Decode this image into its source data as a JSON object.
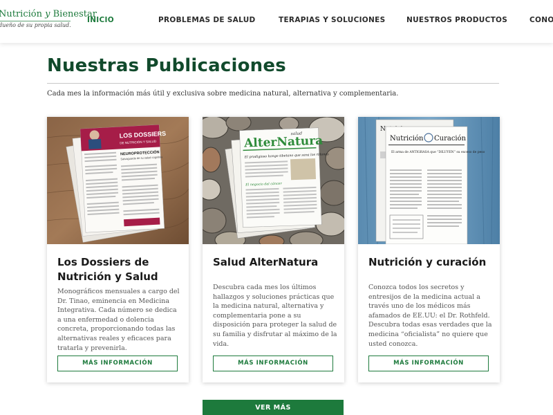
{
  "brand": {
    "title_part1": "Nutrición",
    "title_amp": "y",
    "title_part2": "Bienestar",
    "tagline": "dueño de su propia salud."
  },
  "nav": {
    "items": [
      {
        "label": "INICIO",
        "active": true
      },
      {
        "label": "PROBLEMAS DE SALUD",
        "active": false
      },
      {
        "label": "TERAPIAS Y SOLUCIONES",
        "active": false
      },
      {
        "label": "NUESTROS PRODUCTOS",
        "active": false
      },
      {
        "label": "CONOZ",
        "active": false
      }
    ]
  },
  "section": {
    "title": "Nuestras Publicaciones",
    "subtitle": "Cada mes la información más útil y exclusiva sobre medicina natural, alternativa y complementaria."
  },
  "cards": [
    {
      "title": "Los Dossiers de Nutrición y Salud",
      "description": "Monográficos mensuales a cargo del Dr. Tinao, eminencia en Medicina Integrativa. Cada número se dedica a una enfermedad o dolencia concreta, proporcionando todas las alternativas reales y eficaces para tratarla y prevenirla.",
      "button": "MÁS INFORMACIÓN",
      "cover": {
        "masthead": "LOS DOSSIERS",
        "subhead": "DE NUTRICIÓN Y SALUD",
        "headline": "NEUROPROTECCIÓN",
        "deck": "Salvaguarde de su salud cognitiva"
      }
    },
    {
      "title": "Salud AlterNatura",
      "description": "Descubra cada mes los últimos hallazgos y soluciones prácticas que la medicina natural, alternativa y complementaria pone a su disposición para proteger la salud de su familia y disfrutar al máximo de la vida.",
      "button": "MÁS INFORMACIÓN",
      "cover": {
        "masthead": "AlterNatura",
        "kicker": "salud",
        "headline": "El prodigioso hongo tibetano que sana los riñones",
        "sub": "El negocio del cáncer"
      }
    },
    {
      "title": "Nutrición y curación",
      "description": "Conozca todos los secretos y entresijos de la medicina actual a través uno de los médicos más afamados de EE.UU: el Dr. Rothfeld. Descubra todas esas verdades que la medicina “oficialista” no quiere que usted conozca.",
      "button": "MÁS INFORMACIÓN",
      "cover": {
        "masthead_left": "Nutrición",
        "masthead_right": "Curación",
        "headline": "El arma de ANTIGRASA que “DILUYEN” su exceso de peso"
      }
    }
  ],
  "more_button": "VER MÁS",
  "colors": {
    "brand_green": "#1d7a3c",
    "heading_green": "#114a2c"
  }
}
